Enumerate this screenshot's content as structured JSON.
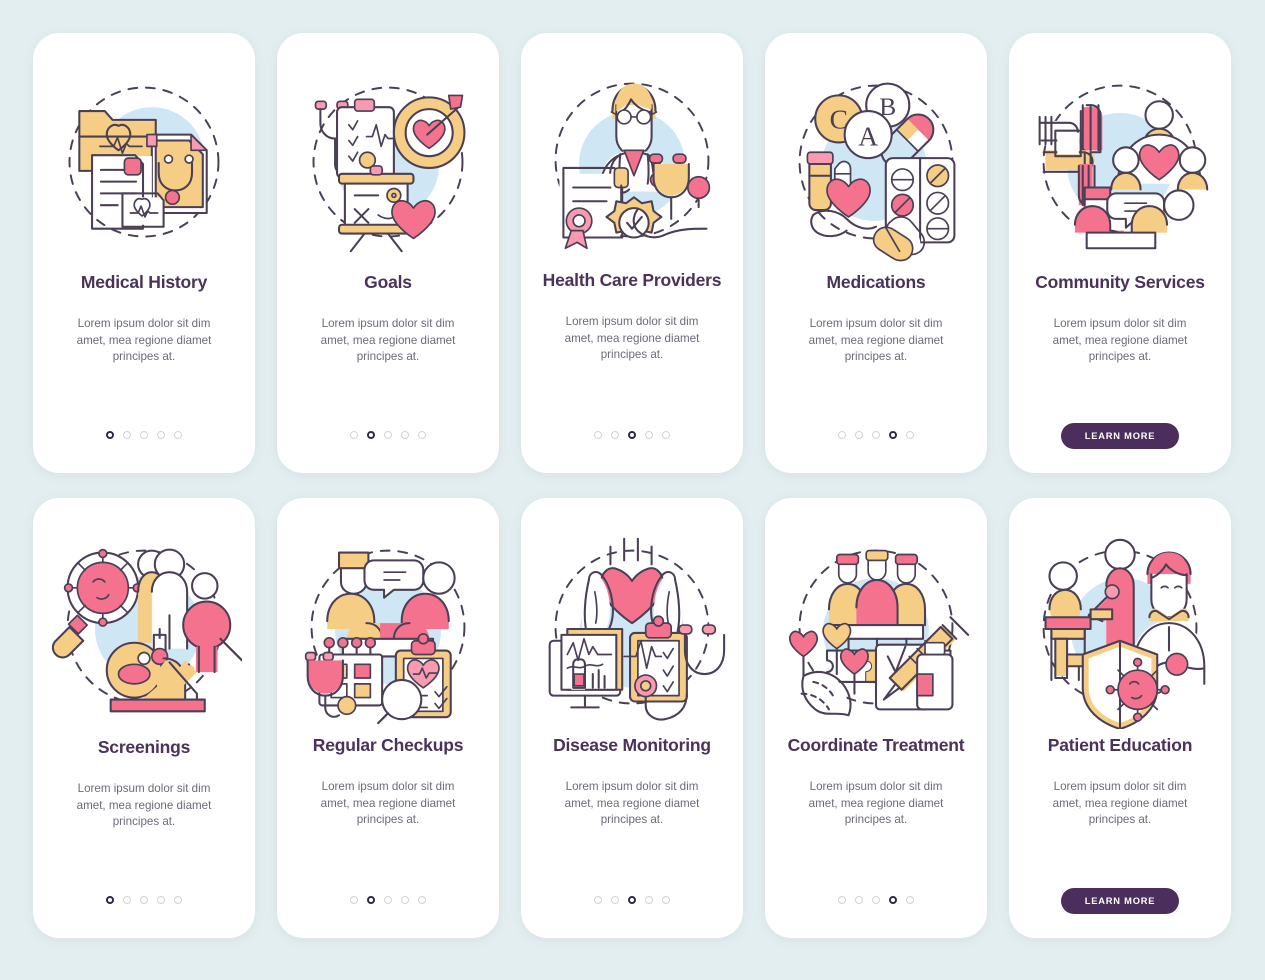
{
  "page": {
    "background_color": "#e3eef0",
    "title_color": "#4a3258",
    "body_color": "#6a6b78",
    "button_color": "#4b2e5c",
    "accent_pink": "#f4728d",
    "accent_yellow": "#f5cd84",
    "accent_blue": "#cfe6f5",
    "dot_active_color": "#2e2a43",
    "dot_inactive_color": "#d2d2d8"
  },
  "cards": [
    {
      "title": "Medical History",
      "body": "Lorem ipsum dolor sit dim amet, mea regione diamet principes at.",
      "icon": "medical-folder-records-icon",
      "dots": 5,
      "active_dot": 1,
      "cta": null
    },
    {
      "title": "Goals",
      "body": "Lorem ipsum dolor sit dim amet, mea regione diamet principes at.",
      "icon": "target-heart-goals-icon",
      "dots": 5,
      "active_dot": 2,
      "cta": null
    },
    {
      "title": "Health Care Providers",
      "body": "Lorem ipsum dolor sit dim amet, mea regione diamet principes at.",
      "icon": "doctor-certificate-stethoscope-icon",
      "dots": 5,
      "active_dot": 3,
      "cta": null
    },
    {
      "title": "Medications",
      "body": "Lorem ipsum dolor sit dim amet, mea regione diamet principes at.",
      "icon": "pills-vitamins-bottle-icon",
      "dots": 5,
      "active_dot": 4,
      "cta": null
    },
    {
      "title": "Community Services",
      "body": "Lorem ipsum dolor sit dim amet, mea regione diamet principes at.",
      "icon": "hands-together-community-icon",
      "dots": 0,
      "active_dot": 0,
      "cta": "LEARN MORE"
    },
    {
      "title": "Screenings",
      "body": "Lorem ipsum dolor sit dim amet, mea regione diamet principes at.",
      "icon": "microscope-virus-magnifier-icon",
      "dots": 5,
      "active_dot": 1,
      "cta": null
    },
    {
      "title": "Regular Checkups",
      "body": "Lorem ipsum dolor sit dim amet, mea regione diamet principes at.",
      "icon": "calendar-clipboard-consult-icon",
      "dots": 5,
      "active_dot": 2,
      "cta": null
    },
    {
      "title": "Disease Monitoring",
      "body": "Lorem ipsum dolor sit dim amet, mea regione diamet principes at.",
      "icon": "hands-heart-monitor-icon",
      "dots": 5,
      "active_dot": 3,
      "cta": null
    },
    {
      "title": "Coordinate Treatment",
      "body": "Lorem ipsum dolor sit dim amet, mea regione diamet principes at.",
      "icon": "team-puzzle-syringe-icon",
      "dots": 5,
      "active_dot": 4,
      "cta": null
    },
    {
      "title": "Patient Education",
      "body": "Lorem ipsum dolor sit dim amet, mea regione diamet principes at.",
      "icon": "teacher-student-shield-icon",
      "dots": 0,
      "active_dot": 0,
      "cta": "LEARN MORE"
    }
  ]
}
